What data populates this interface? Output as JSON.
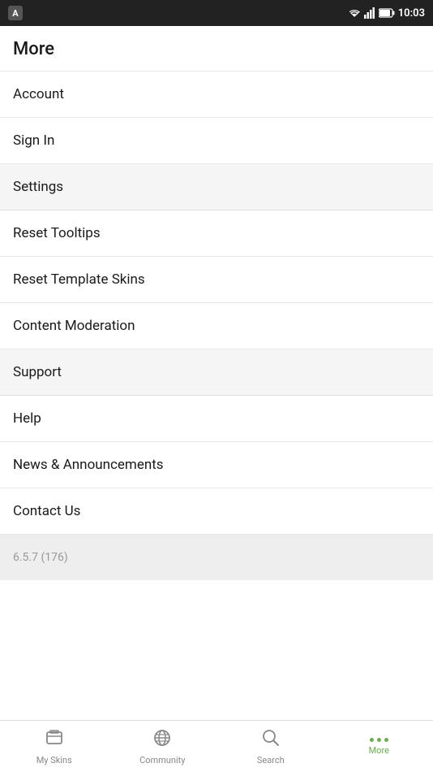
{
  "statusBar": {
    "time": "10:03",
    "appIcon": "A"
  },
  "page": {
    "title": "More"
  },
  "menuItems": [
    {
      "id": "account",
      "label": "Account",
      "section": false
    },
    {
      "id": "sign-in",
      "label": "Sign In",
      "section": false
    },
    {
      "id": "settings",
      "label": "Settings",
      "section": true
    },
    {
      "id": "reset-tooltips",
      "label": "Reset Tooltips",
      "section": false
    },
    {
      "id": "reset-template-skins",
      "label": "Reset Template Skins",
      "section": false
    },
    {
      "id": "content-moderation",
      "label": "Content Moderation",
      "section": false
    },
    {
      "id": "support",
      "label": "Support",
      "section": true
    },
    {
      "id": "help",
      "label": "Help",
      "section": false
    },
    {
      "id": "news-announcements",
      "label": "News & Announcements",
      "section": false
    },
    {
      "id": "contact-us",
      "label": "Contact Us",
      "section": false
    }
  ],
  "version": "6.5.7 (176)",
  "bottomNav": {
    "items": [
      {
        "id": "my-skins",
        "label": "My Skins",
        "icon": "skins",
        "active": false
      },
      {
        "id": "community",
        "label": "Community",
        "icon": "community",
        "active": false
      },
      {
        "id": "search",
        "label": "Search",
        "icon": "search",
        "active": false
      },
      {
        "id": "more",
        "label": "More",
        "icon": "more",
        "active": true
      }
    ]
  }
}
